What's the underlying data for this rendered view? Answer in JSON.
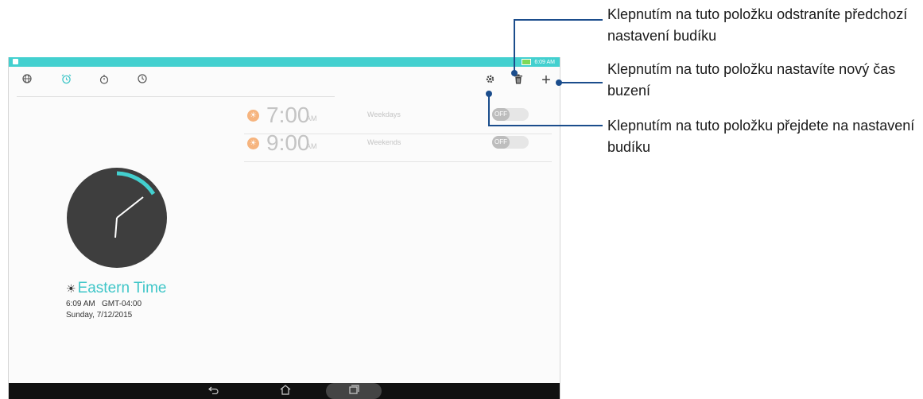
{
  "status_bar": {
    "time": "6:09 AM"
  },
  "toolbar": {
    "tabs": [
      {
        "name": "world-clock-tab",
        "icon": "globe-icon",
        "glyph": "◍"
      },
      {
        "name": "alarm-tab",
        "icon": "alarm-clock-icon",
        "glyph": "⏰"
      },
      {
        "name": "stopwatch-tab",
        "icon": "stopwatch-icon",
        "glyph": "◷"
      },
      {
        "name": "timer-tab",
        "icon": "timer-icon",
        "glyph": "◔"
      }
    ],
    "actions": {
      "settings_glyph": "⚙",
      "delete_glyph": "🗑",
      "add_glyph": "+"
    }
  },
  "alarms": [
    {
      "time": "7:00",
      "ampm": "AM",
      "days": "Weekdays",
      "toggle": "OFF"
    },
    {
      "time": "9:00",
      "ampm": "AM",
      "days": "Weekends",
      "toggle": "OFF"
    }
  ],
  "clock": {
    "timezone_name": "Eastern Time",
    "time_line": "6:09 AM   GMT-04:00",
    "date_line": "Sunday, 7/12/2015"
  },
  "callouts": {
    "delete": "Klepnutím na tuto položku odstraníte předchozí nastavení budíku",
    "add": "Klepnutím na tuto položku nastavíte nový čas buzení",
    "settings": "Klepnutím na tuto položku přejdete na nastavení budíku"
  },
  "colors": {
    "accent": "#43d0cf",
    "clock_dark": "#3e3e3e",
    "callout_line": "#1b4d8c"
  }
}
